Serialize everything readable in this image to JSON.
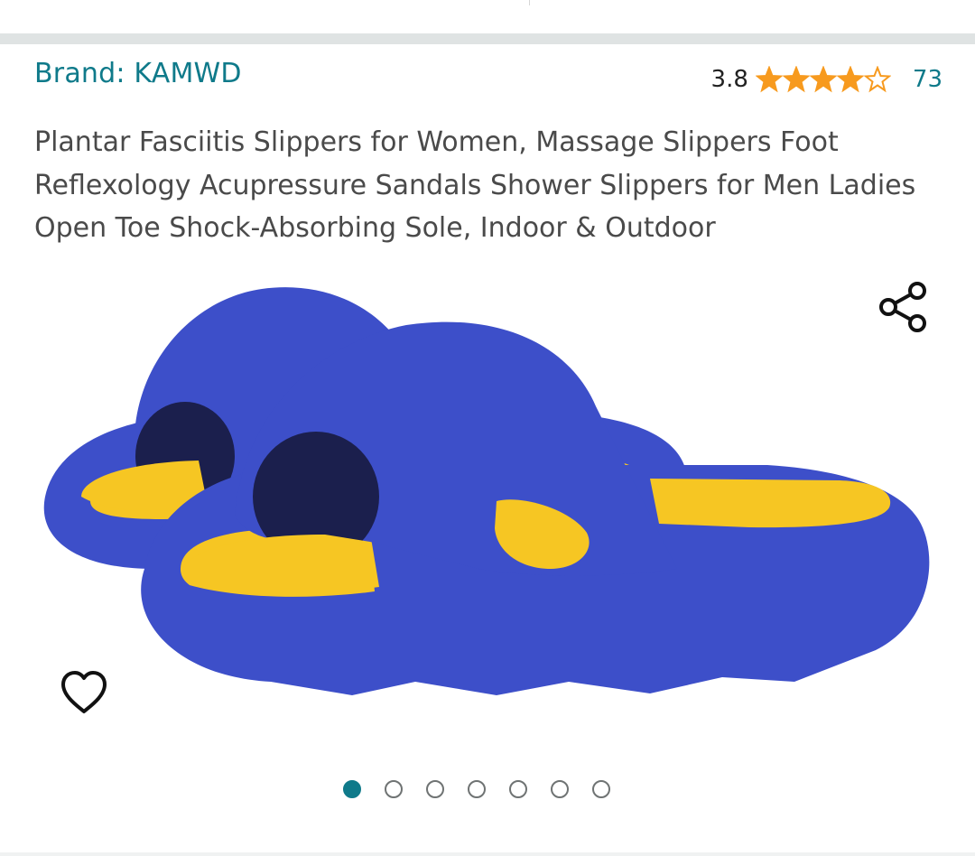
{
  "product": {
    "brand_label": "Brand: KAMWD",
    "title": "Plantar Fasciitis Slippers for Women, Massage Slippers Foot Reflexology Acupressure Sandals Shower Slippers for Men Ladies Open Toe Shock-Absorbing Sole, Indoor & Outdoor",
    "rating": {
      "value": "3.8",
      "stars_filled": 3.8,
      "stars_total": 5,
      "review_count": "73",
      "star_color": "#f79a1e"
    },
    "image": {
      "subject": "blue slide slippers with yellow massage footbed",
      "slide_color": "#3d4fc9",
      "footbed_color": "#f6c623"
    },
    "gallery": {
      "image_count": 7,
      "active_index": 0
    }
  },
  "icons": {
    "share": "share-icon",
    "heart": "heart-icon"
  },
  "colors": {
    "accent": "#0f7a8a"
  }
}
